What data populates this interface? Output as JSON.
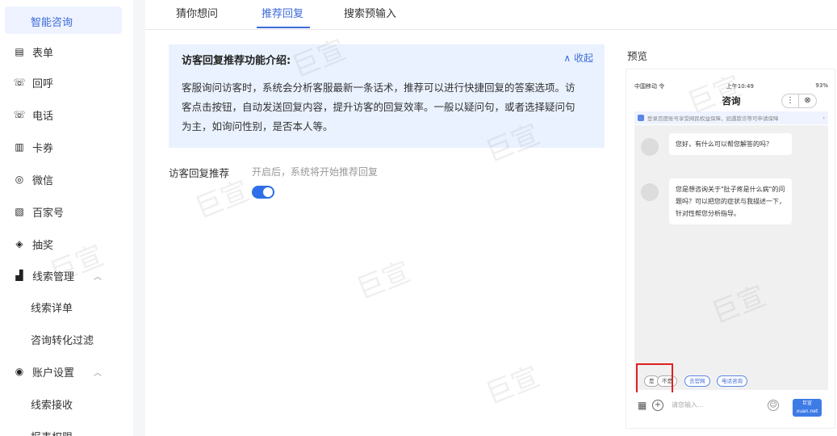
{
  "sidebar": {
    "active_item": "智能咨询",
    "items": [
      {
        "label": "表单",
        "icon": "form-icon",
        "glyph": "▤"
      },
      {
        "label": "回呼",
        "icon": "callback-icon",
        "glyph": "☏"
      },
      {
        "label": "电话",
        "icon": "phone-icon",
        "glyph": "☏"
      },
      {
        "label": "卡券",
        "icon": "coupon-icon",
        "glyph": "▥"
      },
      {
        "label": "微信",
        "icon": "wechat-icon",
        "glyph": "◎"
      },
      {
        "label": "百家号",
        "icon": "baijiahao-icon",
        "glyph": "▧"
      },
      {
        "label": "抽奖",
        "icon": "gift-icon",
        "glyph": "◈"
      },
      {
        "label": "线索管理",
        "icon": "chart-icon",
        "glyph": "▟"
      }
    ],
    "sub_clue": [
      "线索详单",
      "咨询转化过滤"
    ],
    "account_settings": {
      "label": "账户设置",
      "icon": "settings-icon",
      "glyph": "◉"
    },
    "sub_account": [
      "线索接收",
      "报表权限"
    ]
  },
  "tabs": [
    "猜你想问",
    "推荐回复",
    "搜索预输入"
  ],
  "active_tab": "推荐回复",
  "intro": {
    "title": "访客回复推荐功能介绍:",
    "toggle": "∧ 收起",
    "body": "客服询问访客时，系统会分析客服最新一条话术，推荐可以进行快捷回复的答案选项。访客点击按钮，自动发送回复内容，提升访客的回复效率。一般以疑问句，或者选择疑问句为主，如询问性别，是否本人等。"
  },
  "setting": {
    "label": "访客回复推荐",
    "hint": "开启后，系统将开始推荐回复",
    "enabled": true
  },
  "preview": {
    "label": "预览",
    "status_left": "中国移动 令",
    "status_time": "上午10:49",
    "status_right": "93%",
    "title": "咨询",
    "menu_glyph": "⋮",
    "close_glyph": "⊗",
    "notice": "登录百度账号享受网民权益保障，如遇欺诈等可申请保障",
    "notice_arrow": "›",
    "msg1": "您好，有什么可以帮您解答的吗？",
    "msg2": "您是想咨询关于\"肚子疼是什么病\"的问题吗？可以把您的症状与我描述一下，针对性帮您分析指导。",
    "quick_replies": [
      "是",
      "不是",
      "去官网",
      "电话咨询"
    ],
    "input_placeholder": "请您输入...",
    "send_text": "巨宣 xuan.net"
  },
  "watermark": "巨宣",
  "colors": {
    "accent": "#3d6bd8",
    "highlight": "#e02020",
    "intro_bg": "#eaf2ff"
  }
}
